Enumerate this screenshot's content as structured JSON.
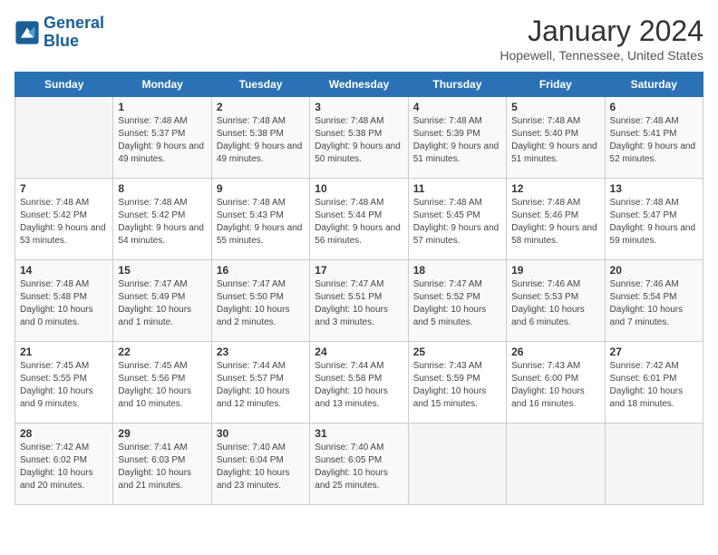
{
  "logo": {
    "line1": "General",
    "line2": "Blue"
  },
  "title": "January 2024",
  "location": "Hopewell, Tennessee, United States",
  "weekdays": [
    "Sunday",
    "Monday",
    "Tuesday",
    "Wednesday",
    "Thursday",
    "Friday",
    "Saturday"
  ],
  "weeks": [
    [
      {
        "day": "",
        "sunrise": "",
        "sunset": "",
        "daylight": ""
      },
      {
        "day": "1",
        "sunrise": "Sunrise: 7:48 AM",
        "sunset": "Sunset: 5:37 PM",
        "daylight": "Daylight: 9 hours and 49 minutes."
      },
      {
        "day": "2",
        "sunrise": "Sunrise: 7:48 AM",
        "sunset": "Sunset: 5:38 PM",
        "daylight": "Daylight: 9 hours and 49 minutes."
      },
      {
        "day": "3",
        "sunrise": "Sunrise: 7:48 AM",
        "sunset": "Sunset: 5:38 PM",
        "daylight": "Daylight: 9 hours and 50 minutes."
      },
      {
        "day": "4",
        "sunrise": "Sunrise: 7:48 AM",
        "sunset": "Sunset: 5:39 PM",
        "daylight": "Daylight: 9 hours and 51 minutes."
      },
      {
        "day": "5",
        "sunrise": "Sunrise: 7:48 AM",
        "sunset": "Sunset: 5:40 PM",
        "daylight": "Daylight: 9 hours and 51 minutes."
      },
      {
        "day": "6",
        "sunrise": "Sunrise: 7:48 AM",
        "sunset": "Sunset: 5:41 PM",
        "daylight": "Daylight: 9 hours and 52 minutes."
      }
    ],
    [
      {
        "day": "7",
        "sunrise": "Sunrise: 7:48 AM",
        "sunset": "Sunset: 5:42 PM",
        "daylight": "Daylight: 9 hours and 53 minutes."
      },
      {
        "day": "8",
        "sunrise": "Sunrise: 7:48 AM",
        "sunset": "Sunset: 5:42 PM",
        "daylight": "Daylight: 9 hours and 54 minutes."
      },
      {
        "day": "9",
        "sunrise": "Sunrise: 7:48 AM",
        "sunset": "Sunset: 5:43 PM",
        "daylight": "Daylight: 9 hours and 55 minutes."
      },
      {
        "day": "10",
        "sunrise": "Sunrise: 7:48 AM",
        "sunset": "Sunset: 5:44 PM",
        "daylight": "Daylight: 9 hours and 56 minutes."
      },
      {
        "day": "11",
        "sunrise": "Sunrise: 7:48 AM",
        "sunset": "Sunset: 5:45 PM",
        "daylight": "Daylight: 9 hours and 57 minutes."
      },
      {
        "day": "12",
        "sunrise": "Sunrise: 7:48 AM",
        "sunset": "Sunset: 5:46 PM",
        "daylight": "Daylight: 9 hours and 58 minutes."
      },
      {
        "day": "13",
        "sunrise": "Sunrise: 7:48 AM",
        "sunset": "Sunset: 5:47 PM",
        "daylight": "Daylight: 9 hours and 59 minutes."
      }
    ],
    [
      {
        "day": "14",
        "sunrise": "Sunrise: 7:48 AM",
        "sunset": "Sunset: 5:48 PM",
        "daylight": "Daylight: 10 hours and 0 minutes."
      },
      {
        "day": "15",
        "sunrise": "Sunrise: 7:47 AM",
        "sunset": "Sunset: 5:49 PM",
        "daylight": "Daylight: 10 hours and 1 minute."
      },
      {
        "day": "16",
        "sunrise": "Sunrise: 7:47 AM",
        "sunset": "Sunset: 5:50 PM",
        "daylight": "Daylight: 10 hours and 2 minutes."
      },
      {
        "day": "17",
        "sunrise": "Sunrise: 7:47 AM",
        "sunset": "Sunset: 5:51 PM",
        "daylight": "Daylight: 10 hours and 3 minutes."
      },
      {
        "day": "18",
        "sunrise": "Sunrise: 7:47 AM",
        "sunset": "Sunset: 5:52 PM",
        "daylight": "Daylight: 10 hours and 5 minutes."
      },
      {
        "day": "19",
        "sunrise": "Sunrise: 7:46 AM",
        "sunset": "Sunset: 5:53 PM",
        "daylight": "Daylight: 10 hours and 6 minutes."
      },
      {
        "day": "20",
        "sunrise": "Sunrise: 7:46 AM",
        "sunset": "Sunset: 5:54 PM",
        "daylight": "Daylight: 10 hours and 7 minutes."
      }
    ],
    [
      {
        "day": "21",
        "sunrise": "Sunrise: 7:45 AM",
        "sunset": "Sunset: 5:55 PM",
        "daylight": "Daylight: 10 hours and 9 minutes."
      },
      {
        "day": "22",
        "sunrise": "Sunrise: 7:45 AM",
        "sunset": "Sunset: 5:56 PM",
        "daylight": "Daylight: 10 hours and 10 minutes."
      },
      {
        "day": "23",
        "sunrise": "Sunrise: 7:44 AM",
        "sunset": "Sunset: 5:57 PM",
        "daylight": "Daylight: 10 hours and 12 minutes."
      },
      {
        "day": "24",
        "sunrise": "Sunrise: 7:44 AM",
        "sunset": "Sunset: 5:58 PM",
        "daylight": "Daylight: 10 hours and 13 minutes."
      },
      {
        "day": "25",
        "sunrise": "Sunrise: 7:43 AM",
        "sunset": "Sunset: 5:59 PM",
        "daylight": "Daylight: 10 hours and 15 minutes."
      },
      {
        "day": "26",
        "sunrise": "Sunrise: 7:43 AM",
        "sunset": "Sunset: 6:00 PM",
        "daylight": "Daylight: 10 hours and 16 minutes."
      },
      {
        "day": "27",
        "sunrise": "Sunrise: 7:42 AM",
        "sunset": "Sunset: 6:01 PM",
        "daylight": "Daylight: 10 hours and 18 minutes."
      }
    ],
    [
      {
        "day": "28",
        "sunrise": "Sunrise: 7:42 AM",
        "sunset": "Sunset: 6:02 PM",
        "daylight": "Daylight: 10 hours and 20 minutes."
      },
      {
        "day": "29",
        "sunrise": "Sunrise: 7:41 AM",
        "sunset": "Sunset: 6:03 PM",
        "daylight": "Daylight: 10 hours and 21 minutes."
      },
      {
        "day": "30",
        "sunrise": "Sunrise: 7:40 AM",
        "sunset": "Sunset: 6:04 PM",
        "daylight": "Daylight: 10 hours and 23 minutes."
      },
      {
        "day": "31",
        "sunrise": "Sunrise: 7:40 AM",
        "sunset": "Sunset: 6:05 PM",
        "daylight": "Daylight: 10 hours and 25 minutes."
      },
      {
        "day": "",
        "sunrise": "",
        "sunset": "",
        "daylight": ""
      },
      {
        "day": "",
        "sunrise": "",
        "sunset": "",
        "daylight": ""
      },
      {
        "day": "",
        "sunrise": "",
        "sunset": "",
        "daylight": ""
      }
    ]
  ]
}
